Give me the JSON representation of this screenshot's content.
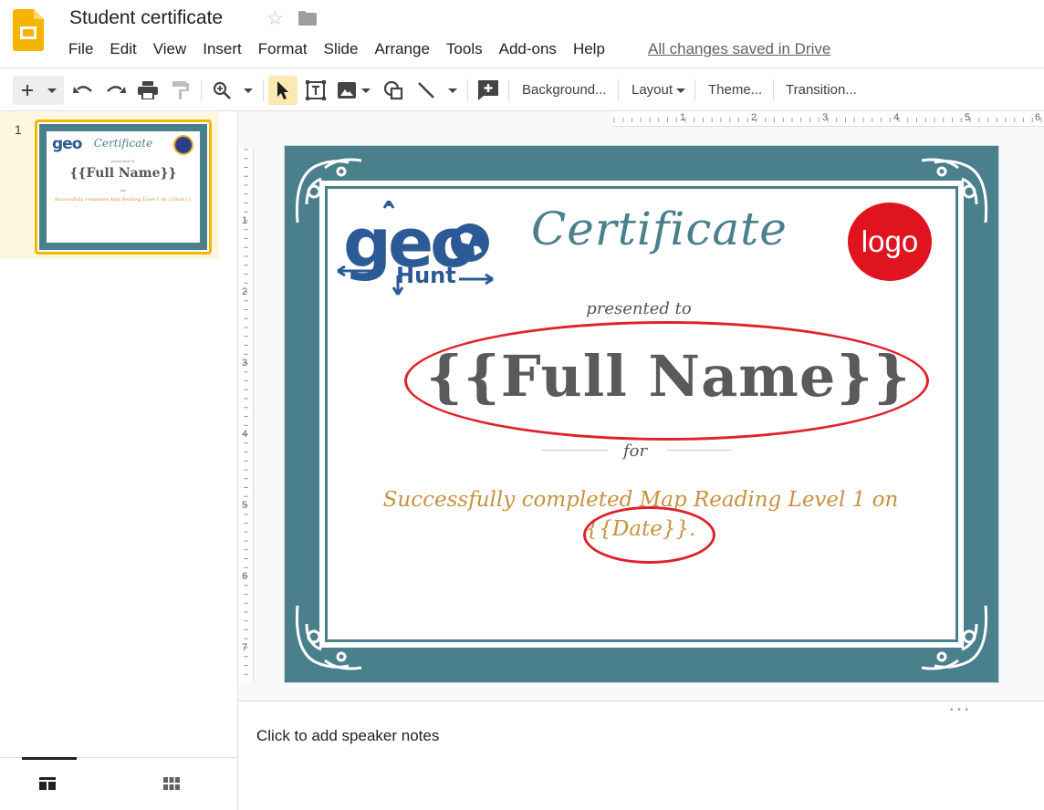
{
  "app": {
    "icon": "google-slides-logo",
    "title": "Student certificate"
  },
  "menu": [
    "File",
    "Edit",
    "View",
    "Insert",
    "Format",
    "Slide",
    "Arrange",
    "Tools",
    "Add-ons",
    "Help"
  ],
  "save_status": "All changes saved in Drive",
  "toolbar": {
    "background": "Background...",
    "layout": "Layout",
    "theme": "Theme...",
    "transition": "Transition..."
  },
  "filmstrip": {
    "slide_number": "1",
    "thumb": {
      "title": "Certificate",
      "brand": "geo",
      "presented": "presented to",
      "name": "{{Full Name}}",
      "for": "for",
      "desc": "Successfully completed Map Reading Level 1 on {{Date}}."
    }
  },
  "rulers": {
    "horizontal": [
      "1",
      "2",
      "3",
      "4",
      "5",
      "6"
    ],
    "vertical": [
      "1",
      "2",
      "3",
      "4",
      "5",
      "6",
      "7"
    ]
  },
  "slide": {
    "brand_geo": "geo",
    "brand_hunt": "Hunt",
    "title": "Certificate",
    "logo": "logo",
    "presented": "presented to",
    "full_name": "{{Full Name}}",
    "for": "for",
    "description": "Successfully completed Map Reading Level 1 on {{Date}}."
  },
  "notes": {
    "placeholder": "Click to add speaker notes"
  },
  "colors": {
    "teal": "#4a7f8c",
    "gold": "#c8913f",
    "red_annotation": "#e0212b",
    "logo_red": "#e0141f"
  }
}
